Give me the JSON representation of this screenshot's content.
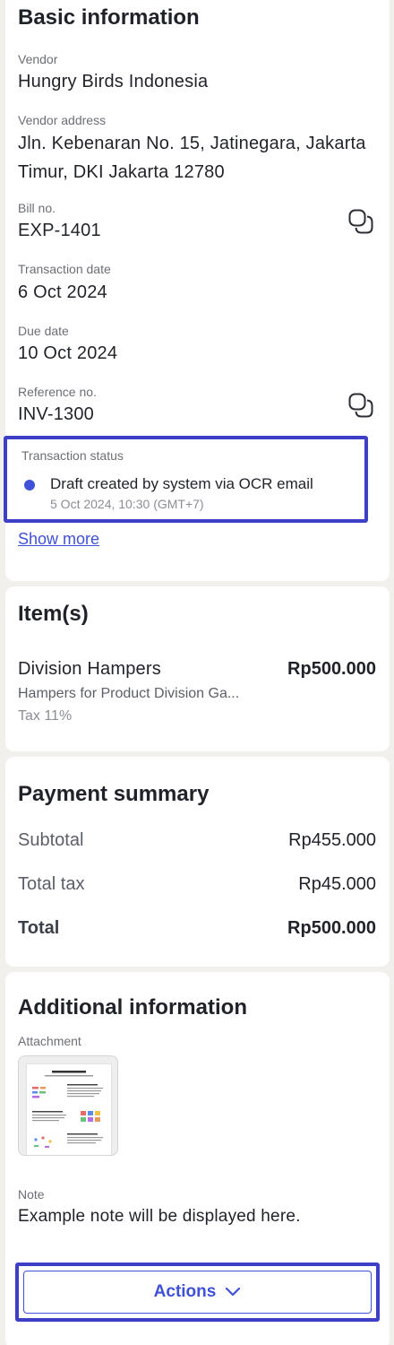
{
  "basic": {
    "title": "Basic information",
    "vendor_label": "Vendor",
    "vendor": "Hungry Birds Indonesia",
    "address_label": "Vendor address",
    "address": "Jln. Kebenaran No. 15, Jatinegara, Jakarta Timur, DKI Jakarta 12780",
    "bill_label": "Bill no.",
    "bill": "EXP-1401",
    "tx_date_label": "Transaction date",
    "tx_date": "6 Oct 2024",
    "due_label": "Due date",
    "due": "10 Oct 2024",
    "ref_label": "Reference no.",
    "ref": "INV-1300",
    "status_label": "Transaction status",
    "status_text": "Draft created by system via OCR email",
    "status_time": "5 Oct 2024, 10:30 (GMT+7)",
    "show_more": "Show more"
  },
  "items": {
    "title": "Item(s)",
    "list": [
      {
        "name": "Division Hampers",
        "desc": "Hampers for Product Division Ga...",
        "tax": "Tax 11%",
        "amount": "Rp500.000"
      }
    ]
  },
  "payment": {
    "title": "Payment summary",
    "subtotal_label": "Subtotal",
    "subtotal": "Rp455.000",
    "tax_label": "Total tax",
    "tax": "Rp45.000",
    "total_label": "Total",
    "total": "Rp500.000"
  },
  "additional": {
    "title": "Additional information",
    "attachment_label": "Attachment",
    "note_label": "Note",
    "note": "Example note will be displayed here."
  },
  "actions": {
    "label": "Actions"
  },
  "colors": {
    "accent": "#3f51d8",
    "highlight": "#3d3fc7",
    "background": "#f1f0ed"
  },
  "icons": {
    "copy": "copy-icon",
    "chevron": "chevron-down-icon",
    "status": "status-dot-icon"
  }
}
